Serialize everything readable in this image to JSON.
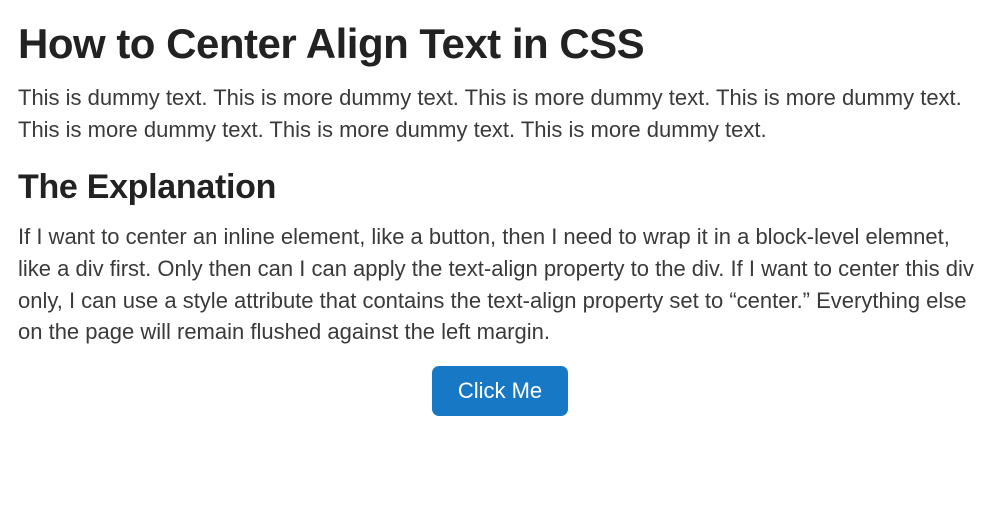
{
  "heading1": "How to Center Align Text in CSS",
  "paragraph1": "This is dummy text. This is more dummy text. This is more dummy text. This is more dummy text. This is more dummy text. This is more dummy text. This is more dummy text.",
  "heading2": "The Explanation",
  "paragraph2": "If I want to center an inline element, like a button, then I need to wrap it in a block-level elemnet, like a div first. Only then can I can apply the text-align property to the div. If I want to center this div only, I can use a style attribute that contains the text-align property set to “center.” Everything else on the page will remain flushed against the left margin.",
  "button_label": "Click Me"
}
